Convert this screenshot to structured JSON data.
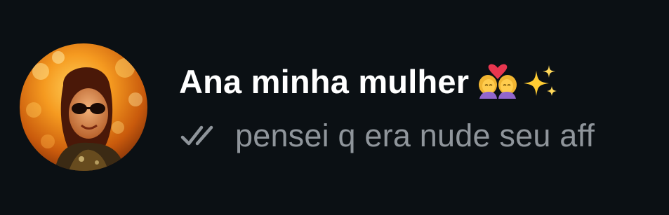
{
  "chat": {
    "contact_name": "Ana minha mulher",
    "name_emojis": [
      "couple-with-heart-icon",
      "sparkles-icon"
    ],
    "last_message": "pensei q era nude seu aff",
    "delivery_status": "double-check-icon"
  },
  "colors": {
    "background": "#0b1014",
    "name": "#ffffff",
    "preview": "#8f959b",
    "check": "#8f959b"
  }
}
